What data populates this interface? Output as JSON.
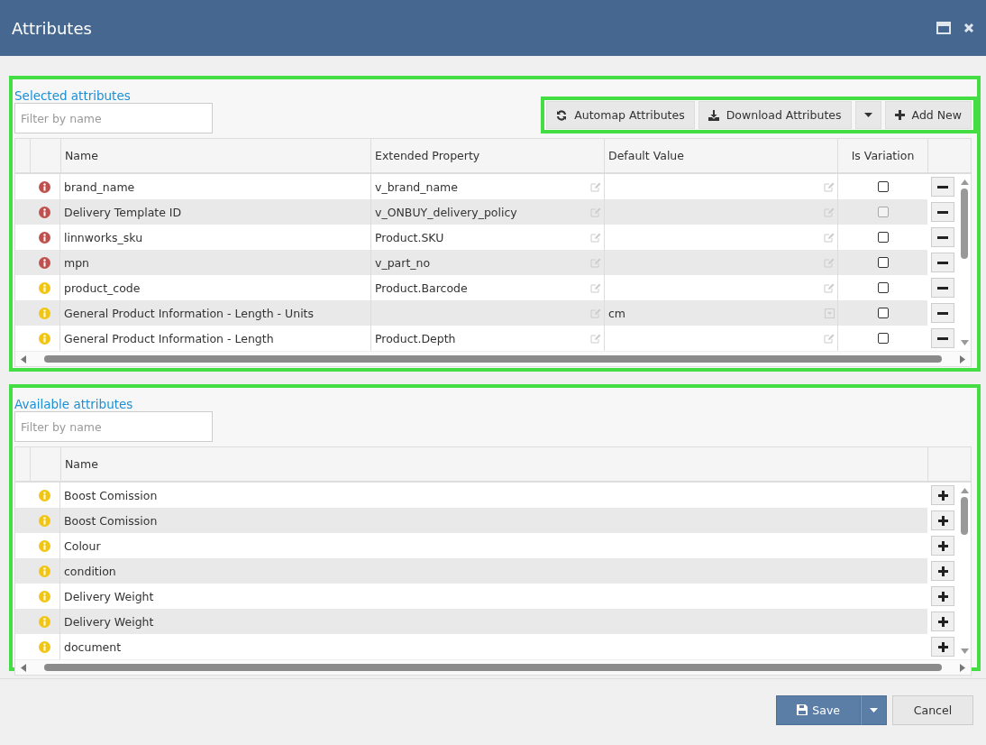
{
  "window": {
    "title": "Attributes"
  },
  "selected_attributes": {
    "title": "Selected attributes",
    "filter": {
      "placeholder": "Filter by name"
    },
    "toolbar": {
      "automap": "Automap Attributes",
      "download": "Download Attributes",
      "add_new": "Add New"
    },
    "columns": [
      "Name",
      "Extended Property",
      "Default Value",
      "Is Variation"
    ],
    "rows": [
      {
        "color": "#c0504d",
        "name": "brand_name",
        "extended_property": "v_brand_name",
        "kind": "text",
        "is_variation": false,
        "disabled": false
      },
      {
        "color": "#c0504d",
        "name": "Delivery Template ID",
        "extended_property": "v_ONBUY_delivery_policy",
        "kind": "text",
        "is_variation": false,
        "disabled": true
      },
      {
        "color": "#c0504d",
        "name": "linnworks_sku",
        "extended_property": "Product.SKU",
        "kind": "text",
        "is_variation": false,
        "disabled": false
      },
      {
        "color": "#c0504d",
        "name": "mpn",
        "extended_property": "v_part_no",
        "kind": "text",
        "is_variation": false,
        "disabled": false
      },
      {
        "color": "#f2c511",
        "name": "product_code",
        "extended_property": "Product.Barcode",
        "kind": "text",
        "is_variation": false,
        "disabled": false
      },
      {
        "color": "#f2c511",
        "name": "General Product Information - Length - Units",
        "default_value": "cm",
        "kind": "dropdown",
        "is_variation": false,
        "disabled": false
      },
      {
        "color": "#f2c511",
        "name": "General Product Information - Length",
        "extended_property": "Product.Depth",
        "kind": "text",
        "is_variation": false,
        "disabled": false
      }
    ]
  },
  "available_attributes": {
    "title": "Available attributes",
    "filter": {
      "placeholder": "Filter by name"
    },
    "columns": [
      "Name"
    ],
    "rows": [
      {
        "color": "#f2c511",
        "name": "Boost Comission"
      },
      {
        "color": "#f2c511",
        "name": "Boost Comission"
      },
      {
        "color": "#f2c511",
        "name": "Colour"
      },
      {
        "color": "#f2c511",
        "name": "condition"
      },
      {
        "color": "#f2c511",
        "name": "Delivery Weight"
      },
      {
        "color": "#f2c511",
        "name": "Delivery Weight"
      },
      {
        "color": "#f2c511",
        "name": "document"
      }
    ]
  },
  "footer": {
    "save": "Save",
    "cancel": "Cancel"
  }
}
